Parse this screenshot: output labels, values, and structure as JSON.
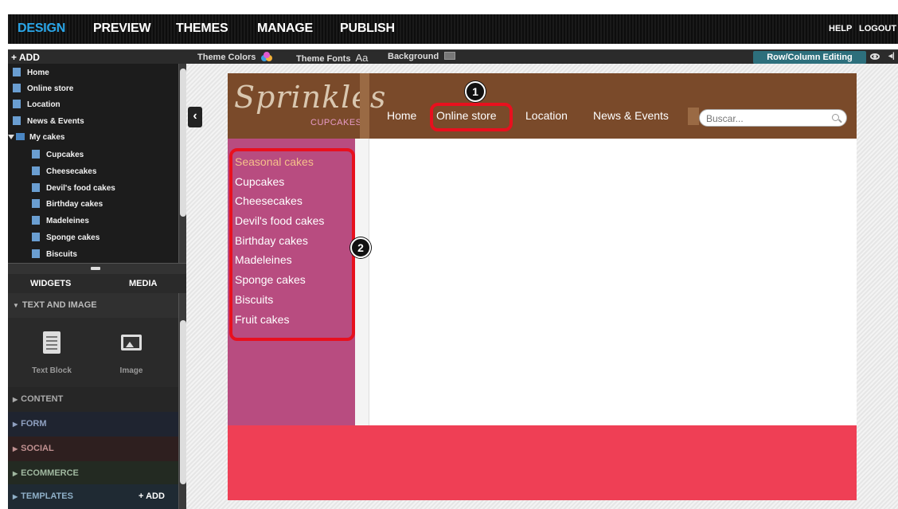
{
  "topnav": {
    "items": [
      "DESIGN",
      "PREVIEW",
      "THEMES",
      "MANAGE",
      "PUBLISH"
    ],
    "help": "HELP",
    "logout": "LOGOUT"
  },
  "toolbar": {
    "add": "+  ADD",
    "theme_colors": "Theme Colors",
    "theme_fonts": "Theme Fonts",
    "theme_fonts_glyph": "Aa",
    "background": "Background",
    "row_column": "Row/Column Editing"
  },
  "tree": {
    "items": [
      {
        "label": "Home"
      },
      {
        "label": "Online store"
      },
      {
        "label": "Location"
      },
      {
        "label": "News & Events"
      },
      {
        "label": "My cakes"
      },
      {
        "label": "Cupcakes"
      },
      {
        "label": "Cheesecakes"
      },
      {
        "label": "Devil's food cakes"
      },
      {
        "label": "Birthday cakes"
      },
      {
        "label": "Madeleines"
      },
      {
        "label": "Sponge cakes"
      },
      {
        "label": "Biscuits"
      }
    ]
  },
  "widgets": {
    "tabs": [
      "WIDGETS",
      "MEDIA"
    ],
    "sections": [
      "TEXT AND IMAGE",
      "CONTENT",
      "FORM",
      "SOCIAL",
      "ECOMMERCE",
      "TEMPLATES"
    ],
    "items": [
      "Text Block",
      "Image"
    ],
    "templates_add": "+ ADD"
  },
  "site": {
    "logo": "Sprinkles",
    "logo_sub": "CUPCAKES",
    "nav": [
      "Home",
      "Online store",
      "Location",
      "News & Events"
    ],
    "search_placeholder": "Buscar...",
    "categories": [
      "Seasonal cakes",
      "Cupcakes",
      "Cheesecakes",
      "Devil's food cakes",
      "Birthday cakes",
      "Madeleines",
      "Sponge cakes",
      "Biscuits",
      "Fruit cakes"
    ]
  },
  "annotations": [
    "1",
    "2"
  ],
  "colors": {
    "accent": "#2aa6e8",
    "header": "#7a4a2a",
    "sidebar_menu": "#b84c80",
    "footer": "#ef3f55",
    "callout": "#e8101e"
  }
}
